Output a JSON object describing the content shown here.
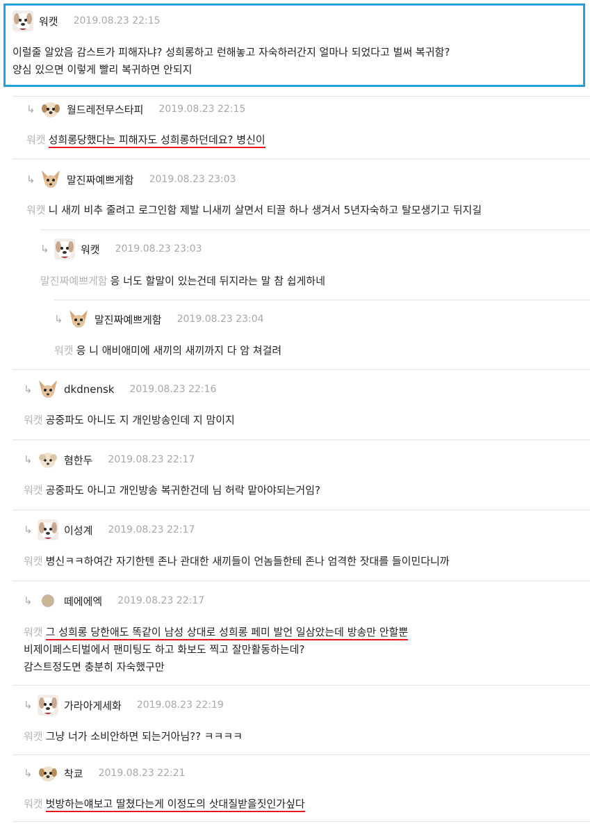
{
  "comments": [
    {
      "author": "워캣",
      "time": "2019.08.23 22:15",
      "avatar": "dog-white-red-icon",
      "mention": "",
      "lines": [
        "이럴줄 알았음 감스트가 피해자냐? 성희롱하고 런해놓고 자숙하러간지 얼마나 되었다고 벌써 복귀함?",
        "양심 있으면 이렇게 빨리 복귀하면 안되지"
      ]
    },
    {
      "author": "월드레전무스타피",
      "time": "2019.08.23 22:15",
      "avatar": "dog-face-icon",
      "mention": "워캣",
      "lines": [
        "성희롱당했다는 피해자도 성희롱하던데요? 병신이"
      ]
    },
    {
      "author": "말진짜예쁘게함",
      "time": "2019.08.23 23:03",
      "avatar": "chihuahua-icon",
      "mention": "워캣",
      "lines": [
        "니 새끼 비추 줄려고 로그인함 제발 니새끼 살면서 티끌 하나 생겨서 5년자숙하고 탈모생기고 뒤지길"
      ]
    },
    {
      "author": "워캣",
      "time": "2019.08.23 23:03",
      "avatar": "dog-white-red-icon",
      "mention": "말진짜예쁘게함",
      "lines": [
        "응 너도 할말이 있는건데 뒤지라는 말 참 쉽게하네"
      ]
    },
    {
      "author": "말진짜예쁘게함",
      "time": "2019.08.23 23:04",
      "avatar": "chihuahua-icon",
      "mention": "워캣",
      "lines": [
        "응 니 애비애미에 새끼의 새끼까지 다 암 쳐걸려"
      ]
    },
    {
      "author": "dkdnensk",
      "time": "2019.08.23 22:16",
      "avatar": "chihuahua-icon",
      "mention": "워캣",
      "lines": [
        "공중파도 아니도 지 개인방송인데 지 맘이지"
      ]
    },
    {
      "author": "혐한두",
      "time": "2019.08.23 22:17",
      "avatar": "dog-fluffy-icon",
      "mention": "워캣",
      "lines": [
        "공중파도 아니고 개인방송 복귀한건데 님 허락 맡아야되는거임?"
      ]
    },
    {
      "author": "이성계",
      "time": "2019.08.23 22:17",
      "avatar": "dog-white-red-icon",
      "mention": "워캣",
      "lines": [
        "병신ㅋㅋ하여간 자기한텐 존나 관대한 새끼들이 언놈들한테 존나 엄격한 잣대를 들이민다니까"
      ]
    },
    {
      "author": "떼에에엑",
      "time": "2019.08.23 22:17",
      "avatar": "circle-tan-icon",
      "mention": "워캣",
      "lines": [
        "그 성희롱 당한애도 똑같이 남성 상대로 성희롱 페미 발언 일삼았는데 방송만 안할뿐",
        "비제이페스티벌에서 팬미팅도 하고 화보도 찍고 잘만활동하는데?",
        "감스트정도면 충분히 자숙했구만"
      ]
    },
    {
      "author": "가라아게세화",
      "time": "2019.08.23 22:19",
      "avatar": "dog-white-red-icon",
      "mention": "워캣",
      "lines": [
        "그냥 너가 소비안하면 되는거아님?? ㅋㅋㅋㅋ"
      ]
    },
    {
      "author": "착쿄",
      "time": "2019.08.23 22:21",
      "avatar": "dog-face-icon",
      "mention": "워캣",
      "lines": [
        "벗방하는얘보고 딸쳤다는게 이정도의 삿대질받을짓인가싶다"
      ]
    }
  ]
}
